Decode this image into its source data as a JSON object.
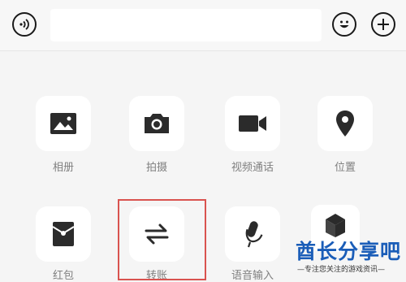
{
  "input_bar": {
    "voice_icon": "voice-wave-icon",
    "emoji_icon": "smiley-icon",
    "plus_icon": "plus-icon",
    "text_value": "",
    "text_placeholder": ""
  },
  "panel": {
    "items": [
      {
        "label": "相册",
        "icon": "album-icon"
      },
      {
        "label": "拍摄",
        "icon": "camera-icon"
      },
      {
        "label": "视频通话",
        "icon": "video-call-icon"
      },
      {
        "label": "位置",
        "icon": "location-icon"
      },
      {
        "label": "红包",
        "icon": "red-packet-icon"
      },
      {
        "label": "转账",
        "icon": "transfer-icon"
      },
      {
        "label": "语音输入",
        "icon": "microphone-icon"
      },
      {
        "label": "",
        "icon": "favorites-box-icon"
      }
    ],
    "highlighted": "转账"
  },
  "watermark": {
    "title": "酋长分享吧",
    "subtitle": "—专注您关注的游戏资讯—"
  },
  "colors": {
    "background": "#f5f5f5",
    "tile": "#ffffff",
    "icon": "#2b2b2b",
    "label": "#808080",
    "highlight": "#d9534f",
    "watermark": "#1a5db8"
  }
}
